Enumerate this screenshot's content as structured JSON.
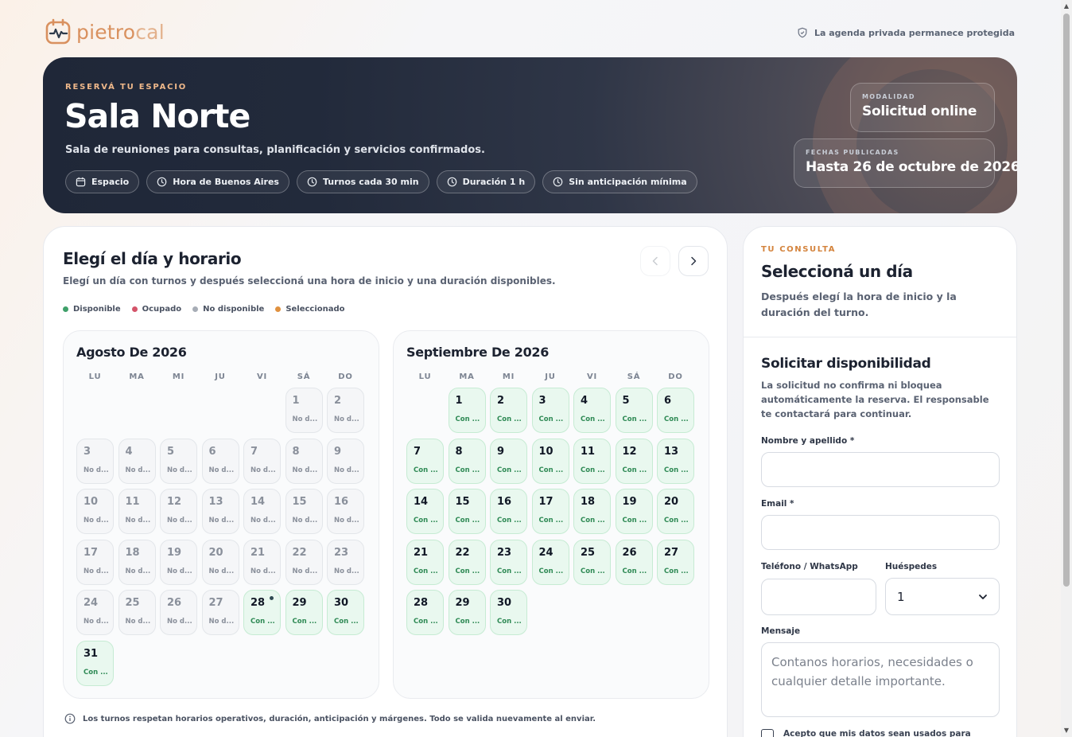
{
  "brand": {
    "name_part1": "pietro",
    "name_part2": "cal",
    "accent": "#d9915f"
  },
  "privacy": {
    "text": "La agenda privada permanece protegida",
    "icon": "shield-icon"
  },
  "hero": {
    "eyebrow": "RESERVÁ TU ESPACIO",
    "title": "Sala Norte",
    "subtitle": "Sala de reuniones para consultas, planificación y servicios confirmados.",
    "chips": [
      {
        "label": "Espacio",
        "icon": "calendar-icon"
      },
      {
        "label": "Hora de Buenos Aires",
        "icon": "clock-icon"
      },
      {
        "label": "Turnos cada 30 min",
        "icon": "clock-icon"
      },
      {
        "label": "Duración 1 h",
        "icon": "clock-icon"
      },
      {
        "label": "Sin anticipación mínima",
        "icon": "clock-icon"
      }
    ],
    "modality": {
      "label": "MODALIDAD",
      "value": "Solicitud online"
    },
    "published": {
      "label": "FECHAS PUBLICADAS",
      "value": "Hasta 26 de octubre de 2026"
    }
  },
  "calendar": {
    "title": "Elegí el día y horario",
    "subtitle": "Elegí un día con turnos y después seleccioná una hora de inicio y una duración disponibles.",
    "legend": [
      {
        "label": "Disponible",
        "color": "#3fa06a"
      },
      {
        "label": "Ocupado",
        "color": "#d4546a"
      },
      {
        "label": "No disponible",
        "color": "#a7adb6"
      },
      {
        "label": "Seleccionado",
        "color": "#e0913f"
      }
    ],
    "weekdays": [
      "LU",
      "MA",
      "MI",
      "JU",
      "VI",
      "SÁ",
      "DO"
    ],
    "status_available": "Con ...",
    "status_unavailable": "No d...",
    "months": [
      {
        "title": "Agosto De 2026",
        "offset": 5,
        "days": [
          {
            "d": "1",
            "s": "na"
          },
          {
            "d": "2",
            "s": "na"
          },
          {
            "d": "3",
            "s": "na"
          },
          {
            "d": "4",
            "s": "na"
          },
          {
            "d": "5",
            "s": "na"
          },
          {
            "d": "6",
            "s": "na"
          },
          {
            "d": "7",
            "s": "na"
          },
          {
            "d": "8",
            "s": "na"
          },
          {
            "d": "9",
            "s": "na"
          },
          {
            "d": "10",
            "s": "na"
          },
          {
            "d": "11",
            "s": "na"
          },
          {
            "d": "12",
            "s": "na"
          },
          {
            "d": "13",
            "s": "na"
          },
          {
            "d": "14",
            "s": "na"
          },
          {
            "d": "15",
            "s": "na"
          },
          {
            "d": "16",
            "s": "na"
          },
          {
            "d": "17",
            "s": "na"
          },
          {
            "d": "18",
            "s": "na"
          },
          {
            "d": "19",
            "s": "na"
          },
          {
            "d": "20",
            "s": "na"
          },
          {
            "d": "21",
            "s": "na"
          },
          {
            "d": "22",
            "s": "na"
          },
          {
            "d": "23",
            "s": "na"
          },
          {
            "d": "24",
            "s": "na"
          },
          {
            "d": "25",
            "s": "na"
          },
          {
            "d": "26",
            "s": "na"
          },
          {
            "d": "27",
            "s": "na"
          },
          {
            "d": "28",
            "s": "av",
            "today": true
          },
          {
            "d": "29",
            "s": "av"
          },
          {
            "d": "30",
            "s": "av"
          },
          {
            "d": "31",
            "s": "av"
          }
        ]
      },
      {
        "title": "Septiembre De 2026",
        "offset": 1,
        "days": [
          {
            "d": "1",
            "s": "av"
          },
          {
            "d": "2",
            "s": "av"
          },
          {
            "d": "3",
            "s": "av"
          },
          {
            "d": "4",
            "s": "av"
          },
          {
            "d": "5",
            "s": "av"
          },
          {
            "d": "6",
            "s": "av"
          },
          {
            "d": "7",
            "s": "av"
          },
          {
            "d": "8",
            "s": "av"
          },
          {
            "d": "9",
            "s": "av"
          },
          {
            "d": "10",
            "s": "av"
          },
          {
            "d": "11",
            "s": "av"
          },
          {
            "d": "12",
            "s": "av"
          },
          {
            "d": "13",
            "s": "av"
          },
          {
            "d": "14",
            "s": "av"
          },
          {
            "d": "15",
            "s": "av"
          },
          {
            "d": "16",
            "s": "av"
          },
          {
            "d": "17",
            "s": "av"
          },
          {
            "d": "18",
            "s": "av"
          },
          {
            "d": "19",
            "s": "av"
          },
          {
            "d": "20",
            "s": "av"
          },
          {
            "d": "21",
            "s": "av"
          },
          {
            "d": "22",
            "s": "av"
          },
          {
            "d": "23",
            "s": "av"
          },
          {
            "d": "24",
            "s": "av"
          },
          {
            "d": "25",
            "s": "av"
          },
          {
            "d": "26",
            "s": "av"
          },
          {
            "d": "27",
            "s": "av"
          },
          {
            "d": "28",
            "s": "av"
          },
          {
            "d": "29",
            "s": "av"
          },
          {
            "d": "30",
            "s": "av"
          }
        ]
      }
    ],
    "footnote": "Los turnos respetan horarios operativos, duración, anticipación y márgenes. Todo se valida nuevamente al enviar."
  },
  "side": {
    "eyebrow": "TU CONSULTA",
    "title": "Seleccioná un día",
    "subtitle": "Después elegí la hora de inicio y la duración del turno."
  },
  "form": {
    "title": "Solicitar disponibilidad",
    "subtitle": "La solicitud no confirma ni bloquea automáticamente la reserva. El responsable te contactará para continuar.",
    "name_label": "Nombre y apellido *",
    "email_label": "Email *",
    "phone_label": "Teléfono / WhatsApp",
    "guests_label": "Huéspedes",
    "guests_value": "1",
    "message_label": "Mensaje",
    "message_placeholder": "Contanos horarios, necesidades o cualquier detalle importante.",
    "consent": "Acepto que mis datos sean usados para responder esta"
  }
}
